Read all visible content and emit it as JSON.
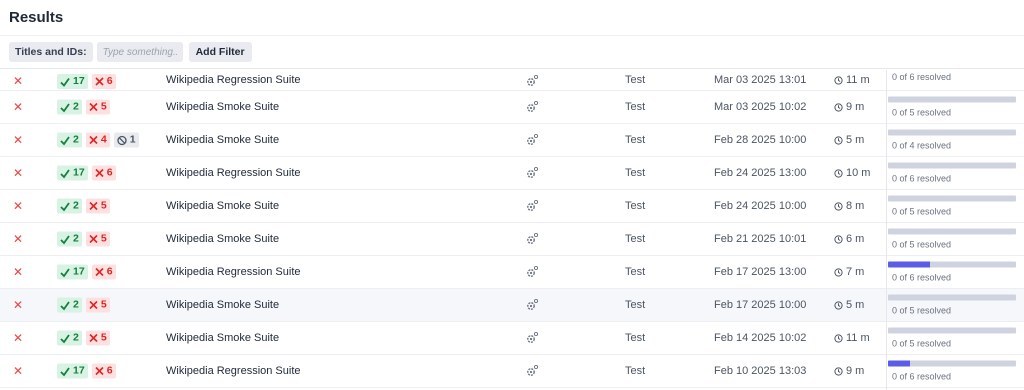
{
  "header": {
    "title": "Results"
  },
  "filter": {
    "label": "Titles and IDs:",
    "placeholder": "Type something...",
    "add_filter": "Add Filter"
  },
  "colors": {
    "pass": "#15803d",
    "fail": "#dc2626",
    "progress": "#5b5de6"
  },
  "rows": [
    {
      "status": "✕",
      "pass": "17",
      "fail": "6",
      "skip": "",
      "suite": "Wikipedia Regression Suite",
      "env": "Test",
      "date": "Mar 03 2025 13:01",
      "duration": "11 m",
      "progress": 0,
      "resolved": "0 of 6 resolved"
    },
    {
      "status": "✕",
      "pass": "2",
      "fail": "5",
      "skip": "",
      "suite": "Wikipedia Smoke Suite",
      "env": "Test",
      "date": "Mar 03 2025 10:02",
      "duration": "9 m",
      "progress": 0,
      "resolved": "0 of 5 resolved"
    },
    {
      "status": "✕",
      "pass": "2",
      "fail": "4",
      "skip": "1",
      "suite": "Wikipedia Smoke Suite",
      "env": "Test",
      "date": "Feb 28 2025 10:00",
      "duration": "5 m",
      "progress": 0,
      "resolved": "0 of 4 resolved"
    },
    {
      "status": "✕",
      "pass": "17",
      "fail": "6",
      "skip": "",
      "suite": "Wikipedia Regression Suite",
      "env": "Test",
      "date": "Feb 24 2025 13:00",
      "duration": "10 m",
      "progress": 0,
      "resolved": "0 of 6 resolved"
    },
    {
      "status": "✕",
      "pass": "2",
      "fail": "5",
      "skip": "",
      "suite": "Wikipedia Smoke Suite",
      "env": "Test",
      "date": "Feb 24 2025 10:00",
      "duration": "8 m",
      "progress": 0,
      "resolved": "0 of 5 resolved"
    },
    {
      "status": "✕",
      "pass": "2",
      "fail": "5",
      "skip": "",
      "suite": "Wikipedia Smoke Suite",
      "env": "Test",
      "date": "Feb 21 2025 10:01",
      "duration": "6 m",
      "progress": 0,
      "resolved": "0 of 5 resolved"
    },
    {
      "status": "✕",
      "pass": "17",
      "fail": "6",
      "skip": "",
      "suite": "Wikipedia Regression Suite",
      "env": "Test",
      "date": "Feb 17 2025 13:00",
      "duration": "7 m",
      "progress": 0.33,
      "resolved": "0 of 6 resolved"
    },
    {
      "status": "✕",
      "pass": "2",
      "fail": "5",
      "skip": "",
      "suite": "Wikipedia Smoke Suite",
      "env": "Test",
      "date": "Feb 17 2025 10:00",
      "duration": "5 m",
      "progress": 0,
      "resolved": "0 of 5 resolved"
    },
    {
      "status": "✕",
      "pass": "2",
      "fail": "5",
      "skip": "",
      "suite": "Wikipedia Smoke Suite",
      "env": "Test",
      "date": "Feb 14 2025 10:02",
      "duration": "11 m",
      "progress": 0,
      "resolved": "0 of 5 resolved"
    },
    {
      "status": "✕",
      "pass": "17",
      "fail": "6",
      "skip": "",
      "suite": "Wikipedia Regression Suite",
      "env": "Test",
      "date": "Feb 10 2025 13:03",
      "duration": "9 m",
      "progress": 0.17,
      "resolved": "0 of 6 resolved"
    }
  ]
}
